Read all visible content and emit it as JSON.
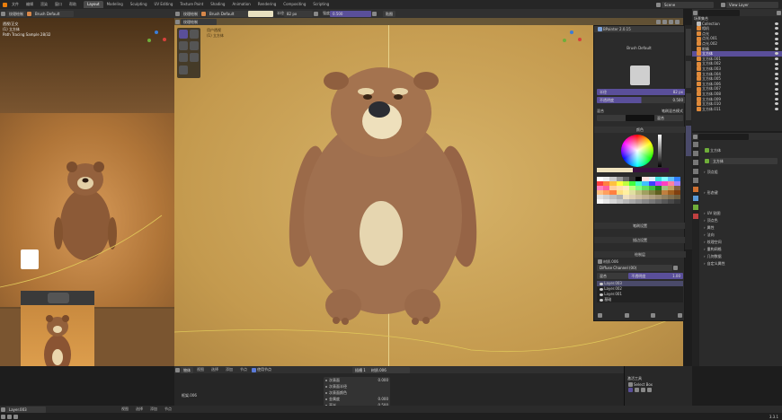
{
  "topbar": {
    "menus": [
      "文件",
      "编辑",
      "渲染",
      "窗口",
      "帮助"
    ],
    "workspaces": [
      "Layout",
      "Modeling",
      "Sculpting",
      "UV Editing",
      "Texture Paint",
      "Shading",
      "Animation",
      "Rendering",
      "Compositing",
      "Scripting"
    ],
    "active_workspace": "Layout",
    "scene": "Scene",
    "view_layer": "View Layer"
  },
  "left_viewport": {
    "mode": "纹理绘制",
    "brush": "Brush Default",
    "info_title": "透视/正交",
    "info_obj": "(1) 立方体",
    "info_samples": "Path Tracing Sample 28/32"
  },
  "main_viewport": {
    "mode": "纹理绘制",
    "brush": "Brush Default",
    "radius_label": "半径",
    "radius_value": "82 px",
    "strength_label": "强度",
    "strength_value": "0.500",
    "info_title": "用户透视",
    "info_obj": "(1) 立方体",
    "texture_slot": "贴图"
  },
  "bpainter": {
    "title": "BPainter 2.0.15",
    "brush_name": "Brush Default",
    "radius_label": "半径",
    "radius_value": "82 px",
    "strength_label": "不透明度",
    "strength_value": "0.500",
    "blend_label": "混合",
    "blend_value": "混合",
    "blend_mode_label": "笔刷混合模式",
    "section_color": "颜色",
    "section_brush_settings": "笔刷设置",
    "section_stroke": "描边设置",
    "section_layers": "绘制层",
    "material": "材质.006",
    "channel": "Diffuse Channel (00)",
    "layer_opacity_label": "不透明度",
    "layer_opacity_value": "1.00",
    "layers": [
      "Layer.003",
      "Layer.002",
      "Layer.001",
      "基础"
    ]
  },
  "outliner": {
    "title": "场景集合",
    "items": [
      {
        "name": "Collection",
        "selected": false
      },
      {
        "name": "相机",
        "selected": false
      },
      {
        "name": "点光",
        "selected": false
      },
      {
        "name": "点光.001",
        "selected": false
      },
      {
        "name": "点光.002",
        "selected": false
      },
      {
        "name": "眼睛",
        "selected": false
      },
      {
        "name": "立方体",
        "selected": true
      },
      {
        "name": "立方体.001",
        "selected": false
      },
      {
        "name": "立方体.002",
        "selected": false
      },
      {
        "name": "立方体.003",
        "selected": false
      },
      {
        "name": "立方体.004",
        "selected": false
      },
      {
        "name": "立方体.005",
        "selected": false
      },
      {
        "name": "立方体.006",
        "selected": false
      },
      {
        "name": "立方体.007",
        "selected": false
      },
      {
        "name": "立方体.008",
        "selected": false
      },
      {
        "name": "立方体.009",
        "selected": false
      },
      {
        "name": "立方体.010",
        "selected": false
      },
      {
        "name": "立方体.011",
        "selected": false
      }
    ]
  },
  "properties": {
    "object": "立方体",
    "sub": "立方体",
    "sections": [
      "顶点组",
      "形态键",
      "UV 贴图",
      "顶点色",
      "属性",
      "法向",
      "纹理空间",
      "重构网格",
      "几何数据",
      "自定义属性"
    ]
  },
  "node_editor": {
    "menus": [
      "视图",
      "选择",
      "添加",
      "节点"
    ],
    "use_nodes": "使用节点",
    "object_label": "物体",
    "material": "材质.006",
    "slot": "插槽 1",
    "frame_label": "框架.006",
    "props": [
      {
        "label": "次表面",
        "value": "0.000"
      },
      {
        "label": "次表面半径",
        "value": ""
      },
      {
        "label": "次表面颜色",
        "value": ""
      },
      {
        "label": "金属度",
        "value": "0.000"
      },
      {
        "label": "高光",
        "value": "0.500"
      }
    ]
  },
  "image_editor": {
    "sidebar_title": "激活工具",
    "tool": "Select Box"
  },
  "status": {
    "left": "Layer.003",
    "middle": [
      "视图",
      "选择",
      "添加",
      "节点"
    ],
    "version": "3.3.1"
  },
  "colors": {
    "accent": "#5a4f9a",
    "viewport_bg": "#c9a35a",
    "bear": "#9b6a49",
    "belly": "#e6d6b0"
  }
}
